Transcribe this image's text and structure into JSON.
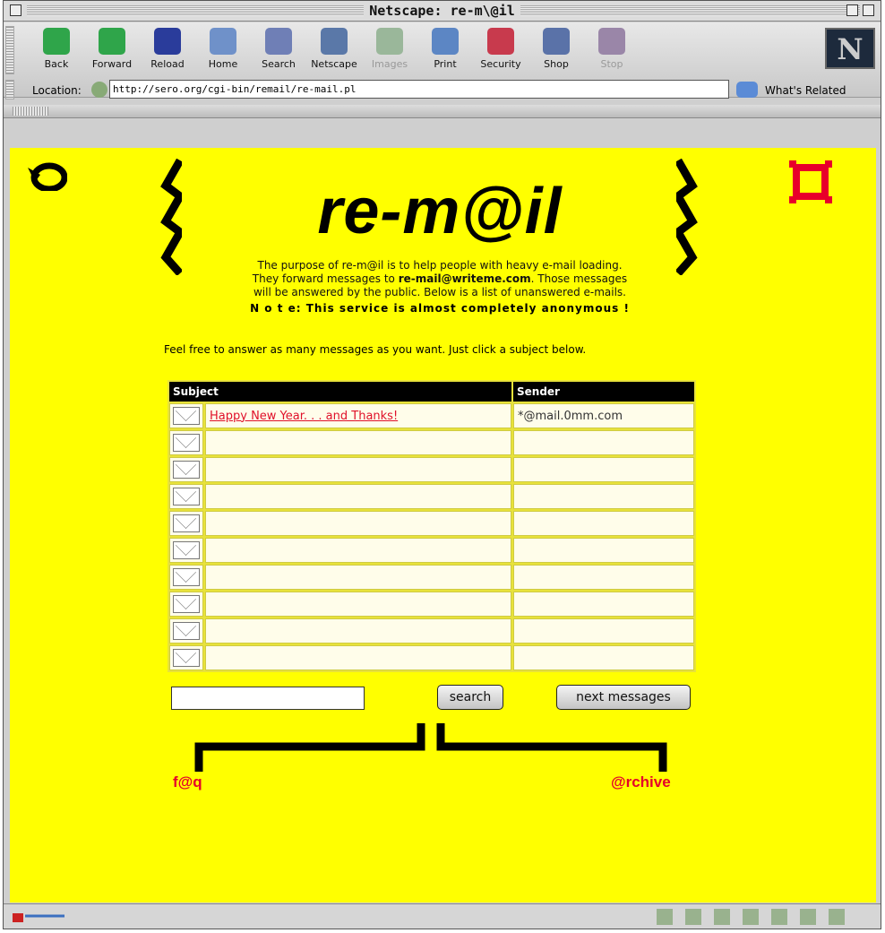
{
  "window": {
    "title": "Netscape: re-m\\@il"
  },
  "toolbar": {
    "buttons": [
      {
        "label": "Back",
        "color": "#2fa54a"
      },
      {
        "label": "Forward",
        "color": "#2fa54a"
      },
      {
        "label": "Reload",
        "color": "#2a3c9b"
      },
      {
        "label": "Home",
        "color": "#6f91c9"
      },
      {
        "label": "Search",
        "color": "#6f7fb6"
      },
      {
        "label": "Netscape",
        "color": "#5a78a8"
      },
      {
        "label": "Images",
        "color": "#9ab79a"
      },
      {
        "label": "Print",
        "color": "#5c86c4"
      },
      {
        "label": "Security",
        "color": "#c83a4d"
      },
      {
        "label": "Shop",
        "color": "#5a72a8"
      },
      {
        "label": "Stop",
        "color": "#9a86a8"
      }
    ],
    "logo": "N"
  },
  "location": {
    "label": "Location:",
    "url": "http://sero.org/cgi-bin/remail/re-mail.pl",
    "related": "What's Related"
  },
  "page": {
    "logo": "re-m@il",
    "intro_1": "The purpose of re-m@il is to help people with heavy e-mail loading.",
    "intro_2a": "They forward messages to ",
    "intro_2b": "re-mail@writeme.com",
    "intro_2c": ". Those messages",
    "intro_3": "will be answered by the public. Below is a list of unanswered e-mails.",
    "note": "N o t e:  This service is almost completely anonymous !",
    "instruction": "Feel free to answer as many messages as you want. Just click a subject below."
  },
  "table": {
    "headers": {
      "subject": "Subject",
      "sender": "Sender"
    },
    "rows": [
      {
        "subject": "Happy New Year. . . and Thanks!",
        "sender": "*@mail.0mm.com"
      },
      {
        "subject": "",
        "sender": ""
      },
      {
        "subject": "",
        "sender": ""
      },
      {
        "subject": "",
        "sender": ""
      },
      {
        "subject": "",
        "sender": ""
      },
      {
        "subject": "",
        "sender": ""
      },
      {
        "subject": "",
        "sender": ""
      },
      {
        "subject": "",
        "sender": ""
      },
      {
        "subject": "",
        "sender": ""
      },
      {
        "subject": "",
        "sender": ""
      }
    ]
  },
  "controls": {
    "search_button": "search",
    "next_button": "next messages",
    "search_value": ""
  },
  "links": {
    "faq": "f@q",
    "archive": "@rchive"
  },
  "colors": {
    "page_bg": "#ffff00",
    "accent_red": "#e5002a"
  }
}
